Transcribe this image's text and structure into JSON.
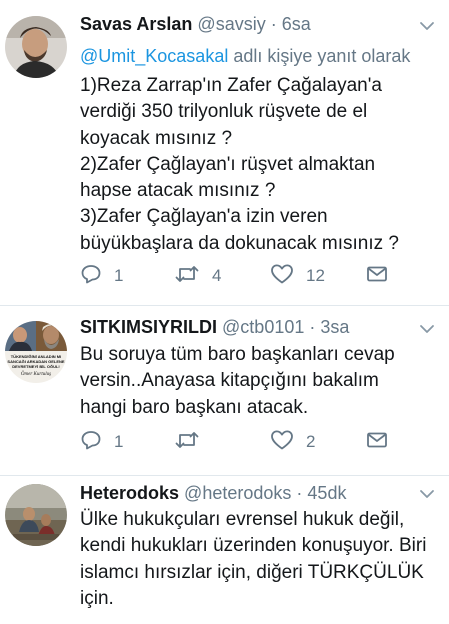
{
  "tweets": [
    {
      "name": "Savas Arslan",
      "handle": "@savsiy",
      "separator": "·",
      "time": "6sa",
      "reply_mention": "@Umit_Kocasakal",
      "reply_suffix": " adlı kişiye yanıt olarak",
      "text": "1)Reza Zarrap'ın Zafer Çağalayan'a\nverdiği 350 trilyonluk rüşvete de el\nkoyacak mısınız ?\n2)Zafer Çağlayan'ı rüşvet almaktan\nhapse atacak mısınız ?\n3)Zafer Çağlayan'a izin veren\nbüyükbaşlara da dokunacak mısınız ?",
      "replies": "1",
      "retweets": "4",
      "likes": "12"
    },
    {
      "name": "SITKIMSIYRILDI",
      "handle": "@ctb0101",
      "separator": "·",
      "time": "3sa",
      "avatar_caption": "TÜKENDİĞİNİ ANLADIN MI SANCAĞI ARKADAN GELENE DEVRETMEYİ BİL OĞUL!",
      "avatar_signature": "Ömer Kurtuluş",
      "text": "Bu soruya tüm baro başkanları cevap\nversin..Anayasa kitapçığını bakalım\nhangi baro başkanı atacak.",
      "replies": "1",
      "retweets": "",
      "likes": "2"
    },
    {
      "name": "Heterodoks",
      "handle": "@heterodoks",
      "separator": "·",
      "time": "45dk",
      "text": "Ülke hukukçuları evrensel hukuk değil,\nkendi hukukları üzerinden konuşuyor. Biri\nislamcı hırsızlar için, diğeri TÜRKÇÜLÜK\niçin."
    }
  ],
  "icons": {
    "reply": "reply-icon",
    "retweet": "retweet-icon",
    "like": "heart-icon",
    "dm": "envelope-icon",
    "menu": "chevron-down-icon"
  },
  "colors": {
    "text": "#14171a",
    "secondary": "#657786",
    "link": "#1b95e0",
    "divider": "#e1e8ed"
  }
}
